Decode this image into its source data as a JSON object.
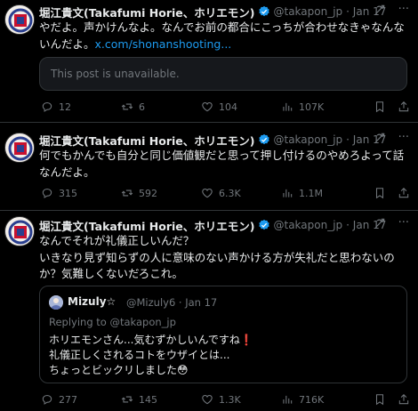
{
  "author": {
    "name": "堀江貴文(Takafumi Horie、ホリエモン)",
    "handle": "@takapon_jp",
    "date": "· Jan 17"
  },
  "tweets": [
    {
      "text": "やだよ。声かけんなよ。なんでお前の都合にこっちが合わせなきゃなんないんだよ。",
      "link": "x.com/shonanshooting...",
      "unavailable": "This post is unavailable.",
      "replies": "12",
      "reposts": "6",
      "likes": "104",
      "views": "107K"
    },
    {
      "text": "何でもかんでも自分と同じ価値観だと思って押し付けるのやめろよって話なんだよ。",
      "replies": "315",
      "reposts": "592",
      "likes": "6.3K",
      "views": "1.1M"
    },
    {
      "text": "なんでそれが礼儀正しいんだ？\nいきなり見ず知らずの人に意味のない声かける方が失礼だと思わないのか？気難しくないだろこれ。",
      "replies": "277",
      "reposts": "145",
      "likes": "1.3K",
      "views": "716K",
      "quote": {
        "name": "Mizuly☆",
        "handle": "@Mizuly6 · Jan 17",
        "replying": "Replying to @takapon_jp",
        "line1": "ホリエモンさん...気むずかしいんですね",
        "line2": "礼儀正しくされるコトをウザイとは...",
        "line3": "ちょっとビックリしました",
        "mark": "❗",
        "emoji": "😳"
      }
    }
  ],
  "colors": {
    "background": "#000000",
    "text": "#e7e9ea",
    "muted": "#71767b",
    "accent": "#1d9bf0",
    "divider": "#2f3336"
  },
  "icons": [
    "reply-icon",
    "repost-icon",
    "like-icon",
    "views-icon",
    "bookmark-icon",
    "share-icon",
    "grok-icon",
    "more-icon",
    "verified-icon"
  ]
}
